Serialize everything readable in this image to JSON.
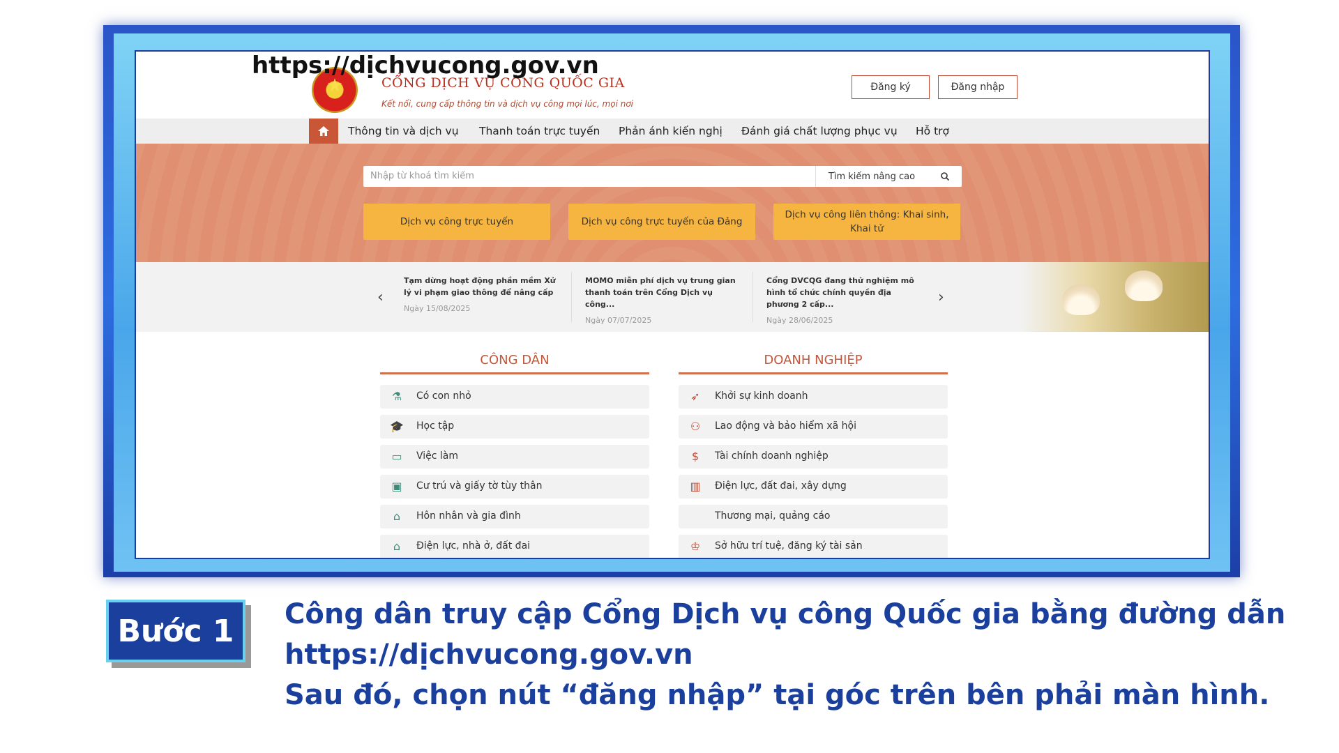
{
  "url_overlay": "https://dịchvucong.gov.vn",
  "portal": {
    "title": "CỔNG DỊCH VỤ CÔNG QUỐC GIA",
    "subtitle": "Kết nối, cung cấp thông tin và dịch vụ công mọi lúc, mọi nơi"
  },
  "header": {
    "register_label": "Đăng ký",
    "login_label": "Đăng nhập"
  },
  "nav": {
    "items": [
      {
        "label": "Thông tin và dịch vụ"
      },
      {
        "label": "Thanh toán trực tuyến"
      },
      {
        "label": "Phản ánh kiến nghị"
      },
      {
        "label": "Đánh giá chất lượng phục vụ"
      },
      {
        "label": "Hỗ trợ"
      }
    ]
  },
  "search": {
    "placeholder": "Nhập từ khoá tìm kiếm",
    "advanced_label": "Tìm kiếm nâng cao"
  },
  "services": [
    {
      "label": "Dịch vụ công trực tuyến"
    },
    {
      "label": "Dịch vụ công trực tuyến của Đảng"
    },
    {
      "label": "Dịch vụ công liên thông: Khai sinh, Khai tử"
    }
  ],
  "news": [
    {
      "title": "Tạm dừng hoạt động phần mềm Xử lý vi phạm giao thông để nâng cấp",
      "date": "Ngày 15/08/2025"
    },
    {
      "title": "MOMO miễn phí dịch vụ trung gian thanh toán trên Cổng Dịch vụ công...",
      "date": "Ngày 07/07/2025"
    },
    {
      "title": "Cổng DVCQG đang thử nghiệm mô hình tổ chức chính quyền địa phương 2 cấp...",
      "date": "Ngày 28/06/2025"
    }
  ],
  "citizen": {
    "heading": "CÔNG DÂN",
    "items": [
      {
        "label": "Có con nhỏ",
        "icon": "baby-bottle-icon"
      },
      {
        "label": "Học tập",
        "icon": "graduation-cap-icon"
      },
      {
        "label": "Việc làm",
        "icon": "briefcase-icon"
      },
      {
        "label": "Cư trú và giấy tờ tùy thân",
        "icon": "id-card-icon"
      },
      {
        "label": "Hôn nhân và gia đình",
        "icon": "family-home-icon"
      },
      {
        "label": "Điện lực, nhà ở, đất đai",
        "icon": "house-land-icon"
      }
    ]
  },
  "business": {
    "heading": "DOANH NGHIỆP",
    "items": [
      {
        "label": "Khởi sự kinh doanh",
        "icon": "rocket-icon"
      },
      {
        "label": "Lao động và bảo hiểm xã hội",
        "icon": "workers-icon"
      },
      {
        "label": "Tài chính doanh nghiệp",
        "icon": "dollar-icon"
      },
      {
        "label": "Điện lực, đất đai, xây dựng",
        "icon": "building-icon"
      },
      {
        "label": "Thương mại, quảng cáo",
        "icon": ""
      },
      {
        "label": "Sở hữu trí tuệ, đăng ký tài sản",
        "icon": "award-icon"
      }
    ]
  },
  "step": {
    "label": "Bước 1"
  },
  "caption": {
    "line1": "Công dân truy cập Cổng Dịch vụ công Quốc gia bằng đường dẫn",
    "line2": "https://dịchvucong.gov.vn",
    "line3": "Sau đó, chọn nút “đăng nhập” tại góc trên bên phải màn hình."
  },
  "colors": {
    "brand": "#c95636",
    "accent": "#f5b540",
    "caption_blue": "#1b3f9c"
  }
}
